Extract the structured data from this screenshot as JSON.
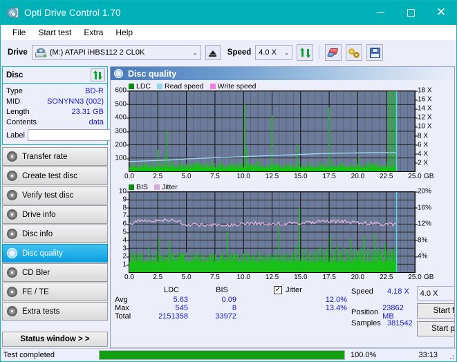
{
  "window": {
    "title": "Opti Drive Control 1.70",
    "icon": "disc-icon",
    "minimize": "–",
    "maximize": "□",
    "close": "✕"
  },
  "menu": [
    {
      "label": "File"
    },
    {
      "label": "Start test"
    },
    {
      "label": "Extra"
    },
    {
      "label": "Help"
    }
  ],
  "toolbar": {
    "drive_label": "Drive",
    "drive_value": "(M:)   ATAPI iHBS112  2 CL0K",
    "eject_icon": "eject-icon",
    "speed_label": "Speed",
    "speed_value": "4.0 X",
    "refresh_icon": "refresh-icon",
    "erase_icon": "eraser-icon",
    "tools_icon": "tools-icon",
    "save_icon": "save-icon"
  },
  "disc_panel": {
    "title": "Disc",
    "refresh_icon": "refresh-icon",
    "rows": [
      {
        "key": "Type",
        "value": "BD-R"
      },
      {
        "key": "MID",
        "value": "SONYNN3 (002)"
      },
      {
        "key": "Length",
        "value": "23.31 GB"
      },
      {
        "key": "Contents",
        "value": "data"
      }
    ],
    "label_key": "Label",
    "label_value": "",
    "label_placeholder": "",
    "cd_icon": "cd-icon"
  },
  "sidebar": {
    "items": [
      {
        "label": "Transfer rate",
        "active": false
      },
      {
        "label": "Create test disc",
        "active": false
      },
      {
        "label": "Verify test disc",
        "active": false
      },
      {
        "label": "Drive info",
        "active": false
      },
      {
        "label": "Disc info",
        "active": false
      },
      {
        "label": "Disc quality",
        "active": true
      },
      {
        "label": "CD Bler",
        "active": false
      },
      {
        "label": "FE / TE",
        "active": false
      },
      {
        "label": "Extra tests",
        "active": false
      }
    ],
    "status_window": "Status window > >"
  },
  "main": {
    "title": "Disc quality",
    "icon": "disc-quality-icon"
  },
  "chart_data": [
    {
      "type": "line",
      "name": "top-chart",
      "title": "",
      "xlabel": "GB",
      "ylabel": "",
      "x_unit": "GB",
      "xlim": [
        0.0,
        25.0
      ],
      "xticks": [
        "0.0",
        "2.5",
        "5.0",
        "7.5",
        "10.0",
        "12.5",
        "15.0",
        "17.5",
        "20.0",
        "22.5",
        "25.0"
      ],
      "ylim": [
        0,
        600
      ],
      "yticks": [
        100,
        200,
        300,
        400,
        500,
        600
      ],
      "y2lim": [
        0,
        18
      ],
      "y2ticks": [
        "2 X",
        "4 X",
        "6 X",
        "8 X",
        "10 X",
        "12 X",
        "14 X",
        "16 X",
        "18 X"
      ],
      "grid": true,
      "legend": [
        {
          "label": "LDC",
          "color": "#0a8c14"
        },
        {
          "label": "Read speed",
          "color": "#93d5f0"
        },
        {
          "label": "Write speed",
          "color": "#f07fe0"
        }
      ],
      "series": [
        {
          "name": "LDC",
          "color": "#18c018",
          "kind": "impulse",
          "x": [
            0.1,
            0.3,
            0.5,
            0.7,
            0.9,
            1.1,
            1.3,
            1.5,
            1.7,
            1.9,
            2.1,
            2.3,
            2.5,
            2.7,
            2.9,
            3.1,
            3.3,
            3.5,
            3.7,
            3.9,
            4.1,
            4.3,
            4.5,
            4.7,
            4.9,
            5.1,
            5.3,
            5.5,
            5.7,
            5.9,
            6.1,
            6.3,
            6.5,
            6.7,
            6.9,
            7.1,
            7.3,
            7.5,
            7.7,
            7.9,
            8.1,
            8.3,
            8.5,
            8.7,
            8.9,
            9.1,
            9.3,
            9.5,
            9.7,
            9.9,
            10.1,
            10.3,
            10.5,
            10.7,
            10.9,
            11.1,
            11.3,
            11.5,
            11.7,
            11.9,
            12.1,
            12.3,
            12.5,
            12.7,
            12.9,
            13.1,
            13.3,
            13.5,
            13.7,
            13.9,
            14.1,
            14.3,
            14.5,
            14.7,
            14.9,
            15.1,
            15.3,
            15.5,
            15.7,
            15.9,
            16.1,
            16.3,
            16.5,
            16.7,
            16.9,
            17.1,
            17.3,
            17.5,
            17.7,
            17.9,
            18.1,
            18.3,
            18.5,
            18.7,
            18.9,
            19.1,
            19.3,
            19.5,
            19.7,
            19.9,
            20.1,
            20.3,
            20.5,
            20.7,
            20.9,
            21.1,
            21.3,
            21.5,
            21.7,
            21.9,
            22.1,
            22.3,
            22.5,
            22.7,
            22.9,
            23.1,
            23.3
          ],
          "values": [
            30,
            28,
            34,
            26,
            30,
            40,
            32,
            28,
            30,
            26,
            36,
            30,
            160,
            44,
            30,
            120,
            300,
            28,
            95,
            34,
            26,
            30,
            28,
            40,
            30,
            26,
            32,
            30,
            28,
            60,
            36,
            30,
            28,
            26,
            70,
            30,
            34,
            28,
            30,
            26,
            40,
            32,
            30,
            28,
            55,
            30,
            26,
            34,
            28,
            30,
            500,
            180,
            30,
            36,
            28,
            30,
            90,
            40,
            28,
            30,
            60,
            32,
            420,
            30,
            26,
            34,
            28,
            30,
            55,
            30,
            28,
            36,
            30,
            200,
            34,
            28,
            30,
            26,
            40,
            30,
            32,
            28,
            70,
            30,
            26,
            34,
            30,
            480,
            95,
            30,
            28,
            36,
            30,
            60,
            34,
            28,
            30,
            40,
            30,
            26,
            110,
            34,
            28,
            30,
            80,
            30,
            26,
            36,
            30,
            55,
            28,
            30,
            34
          ],
          "baseline": 30
        },
        {
          "name": "Read speed",
          "color": "#9fdcf5",
          "kind": "line",
          "x": [
            0.0,
            1.0,
            2.0,
            3.0,
            4.0,
            5.0,
            6.0,
            7.0,
            8.0,
            9.0,
            10.0,
            11.0,
            12.0,
            13.0,
            14.0,
            15.0,
            16.0,
            17.0,
            18.0,
            19.0,
            20.0,
            21.0,
            22.0,
            23.0,
            23.4
          ],
          "values_x": [
            2.2,
            2.3,
            2.4,
            2.5,
            2.6,
            2.8,
            2.9,
            3.0,
            3.1,
            3.2,
            3.3,
            3.4,
            3.5,
            3.6,
            3.7,
            3.8,
            3.9,
            4.0,
            4.05,
            4.1,
            4.15,
            4.18,
            4.18,
            4.18,
            4.18
          ]
        }
      ],
      "cursor_x": 23.4
    },
    {
      "type": "line",
      "name": "bottom-chart",
      "title": "",
      "xlabel": "GB",
      "x_unit": "GB",
      "xlim": [
        0.0,
        25.0
      ],
      "xticks": [
        "0.0",
        "2.5",
        "5.0",
        "7.5",
        "10.0",
        "12.5",
        "15.0",
        "17.5",
        "20.0",
        "22.5",
        "25.0"
      ],
      "ylim": [
        0,
        10
      ],
      "yticks": [
        1,
        2,
        3,
        4,
        5,
        6,
        7,
        8,
        9,
        10
      ],
      "y2lim": [
        0,
        20
      ],
      "y2ticks": [
        "4%",
        "8%",
        "12%",
        "16%",
        "20%"
      ],
      "grid": true,
      "legend": [
        {
          "label": "BIS",
          "color": "#0a8c14"
        },
        {
          "label": "Jitter",
          "color": "#d9a8d9"
        }
      ],
      "series": [
        {
          "name": "BIS",
          "color": "#18c018",
          "kind": "impulse",
          "baseline": 1.3,
          "x": [
            0.2,
            0.5,
            0.8,
            1.1,
            1.4,
            1.7,
            2.0,
            2.3,
            2.6,
            2.9,
            3.2,
            3.5,
            3.8,
            4.1,
            4.4,
            4.7,
            5.0,
            5.3,
            5.6,
            5.9,
            6.2,
            6.5,
            6.8,
            7.1,
            7.4,
            7.7,
            8.0,
            8.3,
            8.6,
            8.9,
            9.2,
            9.5,
            9.8,
            10.1,
            10.4,
            10.7,
            11.0,
            11.3,
            11.6,
            11.9,
            12.2,
            12.5,
            12.8,
            13.1,
            13.4,
            13.7,
            14.0,
            14.3,
            14.6,
            14.9,
            15.2,
            15.5,
            15.8,
            16.1,
            16.4,
            16.7,
            17.0,
            17.3,
            17.6,
            17.9,
            18.2,
            18.5,
            18.8,
            19.1,
            19.4,
            19.7,
            20.0,
            20.3,
            20.6,
            20.9,
            21.2,
            21.5,
            21.8,
            22.1,
            22.4,
            22.7,
            23.0,
            23.3
          ],
          "values": [
            1.8,
            2.0,
            1.6,
            2.2,
            1.7,
            3.1,
            1.9,
            1.6,
            4.4,
            2.1,
            1.8,
            4.0,
            2.3,
            1.7,
            2.0,
            2.4,
            1.8,
            1.6,
            2.0,
            2.2,
            1.9,
            1.7,
            1.8,
            2.0,
            1.6,
            1.9,
            2.1,
            1.7,
            5.0,
            2.0,
            1.8,
            2.4,
            2.0,
            1.7,
            2.2,
            1.9,
            1.8,
            2.6,
            2.0,
            1.7,
            2.1,
            1.9,
            2.3,
            5.6,
            2.0,
            2.2,
            1.8,
            2.5,
            3.4,
            8.0,
            2.8,
            3.0,
            2.4,
            2.6,
            2.9,
            3.2,
            2.7,
            3.0,
            4.6,
            2.8,
            3.5,
            2.6,
            3.1,
            2.9,
            4.2,
            3.0,
            2.7,
            3.3,
            4.5,
            3.0,
            2.8,
            4.8,
            3.2,
            2.9,
            3.6,
            3.0,
            2.8,
            3.1
          ]
        },
        {
          "name": "Jitter",
          "color": "#e0b5e0",
          "kind": "line",
          "mean": 6.1,
          "x": [
            0.0,
            1.0,
            2.0,
            3.0,
            4.0,
            5.0,
            6.0,
            7.0,
            8.0,
            9.0,
            10.0,
            11.0,
            12.0,
            13.0,
            14.0,
            15.0,
            16.0,
            17.0,
            18.0,
            19.0,
            20.0,
            21.0,
            22.0,
            23.0,
            23.4
          ],
          "values": [
            6.1,
            6.5,
            6.4,
            6.5,
            6.4,
            6.0,
            5.9,
            5.9,
            5.95,
            5.9,
            6.0,
            6.1,
            6.0,
            6.05,
            6.1,
            6.2,
            6.3,
            6.3,
            6.35,
            6.3,
            6.2,
            6.15,
            6.0,
            5.95,
            6.0
          ]
        }
      ],
      "cursor_x": 23.4
    }
  ],
  "results": {
    "columns": [
      "",
      "LDC",
      "BIS"
    ],
    "rows": [
      {
        "label": "Avg",
        "ldc": "5.63",
        "bis": "0.09",
        "jitter": "12.0%"
      },
      {
        "label": "Max",
        "ldc": "545",
        "bis": "8",
        "jitter": "13.4%"
      },
      {
        "label": "Total",
        "ldc": "2151358",
        "bis": "33972",
        "jitter": ""
      }
    ],
    "jitter_label": "Jitter",
    "jitter_checked": true,
    "jitter_check_glyph": "✓",
    "speed_label": "Speed",
    "speed_value": "4.18 X",
    "position_label": "Position",
    "position_value": "23862 MB",
    "samples_label": "Samples",
    "samples_value": "381542",
    "speed_select": "4.0 X",
    "start_full": "Start full",
    "start_part": "Start part"
  },
  "statusbar": {
    "text": "Test completed",
    "percent": "100.0%",
    "progress": 100,
    "time": "33:13",
    "progress_color": "#12a012"
  }
}
